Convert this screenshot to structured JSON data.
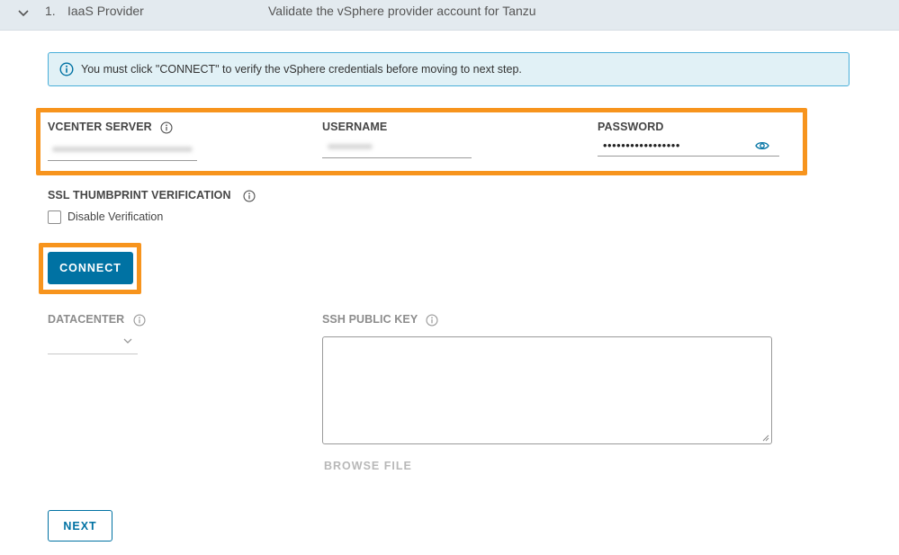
{
  "step": {
    "number": "1.",
    "name": "IaaS Provider",
    "description": "Validate the vSphere provider account for Tanzu"
  },
  "alert": {
    "text": "You must click \"CONNECT\" to verify the vSphere credentials before moving to next step."
  },
  "credentials": {
    "vcenter_label": "VCENTER SERVER",
    "username_label": "USERNAME",
    "password_label": "PASSWORD",
    "password_value": "•••••••••••••••••"
  },
  "ssl": {
    "label": "SSL THUMBPRINT VERIFICATION",
    "checkbox_label": "Disable Verification"
  },
  "buttons": {
    "connect": "CONNECT",
    "browse_file": "BROWSE FILE",
    "next": "NEXT"
  },
  "datacenter": {
    "label": "DATACENTER"
  },
  "ssh": {
    "label": "SSH PUBLIC KEY"
  },
  "colors": {
    "accent": "#0072a3",
    "highlight": "#f7941d",
    "alert_border": "#49afd9",
    "alert_bg": "#e1f1f6"
  },
  "icons": [
    "chevron-down-icon",
    "info-circle-icon",
    "eye-icon"
  ]
}
